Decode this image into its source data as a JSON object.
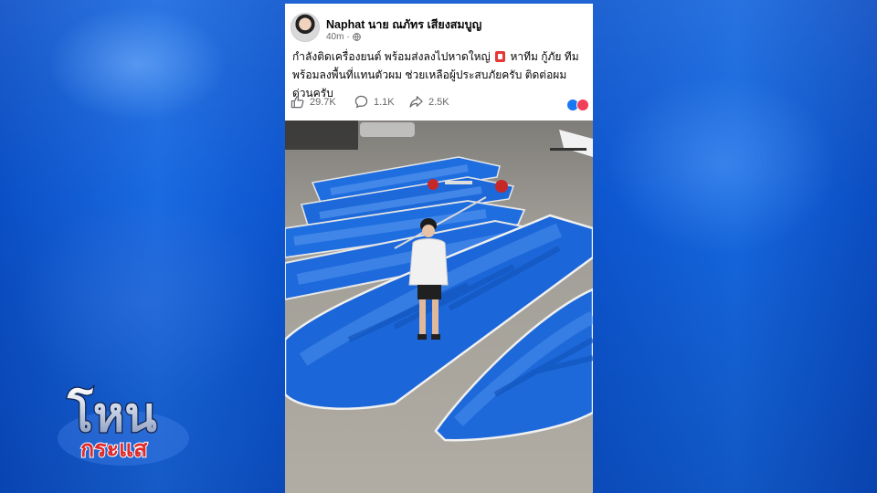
{
  "post": {
    "author": "Naphat นาย ณภัทร เสียงสมบูญ",
    "time": "40m",
    "text_part1": "กำลังติดเครื่องยนต์ พร้อมส่งลงไปหาดใหญ่",
    "text_part2": "หาทีม กู้ภัย ทีม พร้อมลงพื้นที่แทนตัวผม ช่วยเหลือผู้ประสบภัยครับ ติดต่อผมด่วนครับ",
    "likes": "29.7K",
    "comments": "1.1K",
    "shares": "2.5K"
  },
  "overlay": {
    "logo_line1": "โหน",
    "logo_line2": "กระแส"
  },
  "colors": {
    "background_blue": "#0d56cf",
    "boat_blue": "#1e6fe0",
    "logo_red": "#e02a2a"
  },
  "icons": [
    "globe-icon",
    "flag-icon",
    "like-icon",
    "comment-icon",
    "share-icon",
    "like-reaction-icon",
    "love-reaction-icon"
  ]
}
